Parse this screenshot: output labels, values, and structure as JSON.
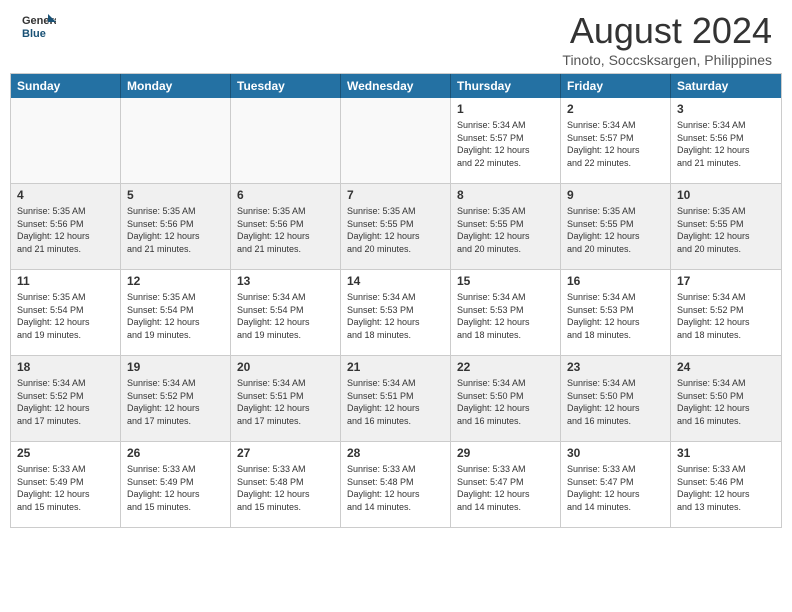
{
  "header": {
    "logo": {
      "general": "General",
      "blue": "Blue"
    },
    "month_year": "August 2024",
    "location": "Tinoto, Soccsksargen, Philippines"
  },
  "days_of_week": [
    "Sunday",
    "Monday",
    "Tuesday",
    "Wednesday",
    "Thursday",
    "Friday",
    "Saturday"
  ],
  "weeks": [
    [
      {
        "day": "",
        "info": "",
        "empty": true
      },
      {
        "day": "",
        "info": "",
        "empty": true
      },
      {
        "day": "",
        "info": "",
        "empty": true
      },
      {
        "day": "",
        "info": "",
        "empty": true
      },
      {
        "day": "1",
        "info": "Sunrise: 5:34 AM\nSunset: 5:57 PM\nDaylight: 12 hours\nand 22 minutes."
      },
      {
        "day": "2",
        "info": "Sunrise: 5:34 AM\nSunset: 5:57 PM\nDaylight: 12 hours\nand 22 minutes."
      },
      {
        "day": "3",
        "info": "Sunrise: 5:34 AM\nSunset: 5:56 PM\nDaylight: 12 hours\nand 21 minutes."
      }
    ],
    [
      {
        "day": "4",
        "info": "Sunrise: 5:35 AM\nSunset: 5:56 PM\nDaylight: 12 hours\nand 21 minutes."
      },
      {
        "day": "5",
        "info": "Sunrise: 5:35 AM\nSunset: 5:56 PM\nDaylight: 12 hours\nand 21 minutes."
      },
      {
        "day": "6",
        "info": "Sunrise: 5:35 AM\nSunset: 5:56 PM\nDaylight: 12 hours\nand 21 minutes."
      },
      {
        "day": "7",
        "info": "Sunrise: 5:35 AM\nSunset: 5:55 PM\nDaylight: 12 hours\nand 20 minutes."
      },
      {
        "day": "8",
        "info": "Sunrise: 5:35 AM\nSunset: 5:55 PM\nDaylight: 12 hours\nand 20 minutes."
      },
      {
        "day": "9",
        "info": "Sunrise: 5:35 AM\nSunset: 5:55 PM\nDaylight: 12 hours\nand 20 minutes."
      },
      {
        "day": "10",
        "info": "Sunrise: 5:35 AM\nSunset: 5:55 PM\nDaylight: 12 hours\nand 20 minutes."
      }
    ],
    [
      {
        "day": "11",
        "info": "Sunrise: 5:35 AM\nSunset: 5:54 PM\nDaylight: 12 hours\nand 19 minutes."
      },
      {
        "day": "12",
        "info": "Sunrise: 5:35 AM\nSunset: 5:54 PM\nDaylight: 12 hours\nand 19 minutes."
      },
      {
        "day": "13",
        "info": "Sunrise: 5:34 AM\nSunset: 5:54 PM\nDaylight: 12 hours\nand 19 minutes."
      },
      {
        "day": "14",
        "info": "Sunrise: 5:34 AM\nSunset: 5:53 PM\nDaylight: 12 hours\nand 18 minutes."
      },
      {
        "day": "15",
        "info": "Sunrise: 5:34 AM\nSunset: 5:53 PM\nDaylight: 12 hours\nand 18 minutes."
      },
      {
        "day": "16",
        "info": "Sunrise: 5:34 AM\nSunset: 5:53 PM\nDaylight: 12 hours\nand 18 minutes."
      },
      {
        "day": "17",
        "info": "Sunrise: 5:34 AM\nSunset: 5:52 PM\nDaylight: 12 hours\nand 18 minutes."
      }
    ],
    [
      {
        "day": "18",
        "info": "Sunrise: 5:34 AM\nSunset: 5:52 PM\nDaylight: 12 hours\nand 17 minutes."
      },
      {
        "day": "19",
        "info": "Sunrise: 5:34 AM\nSunset: 5:52 PM\nDaylight: 12 hours\nand 17 minutes."
      },
      {
        "day": "20",
        "info": "Sunrise: 5:34 AM\nSunset: 5:51 PM\nDaylight: 12 hours\nand 17 minutes."
      },
      {
        "day": "21",
        "info": "Sunrise: 5:34 AM\nSunset: 5:51 PM\nDaylight: 12 hours\nand 16 minutes."
      },
      {
        "day": "22",
        "info": "Sunrise: 5:34 AM\nSunset: 5:50 PM\nDaylight: 12 hours\nand 16 minutes."
      },
      {
        "day": "23",
        "info": "Sunrise: 5:34 AM\nSunset: 5:50 PM\nDaylight: 12 hours\nand 16 minutes."
      },
      {
        "day": "24",
        "info": "Sunrise: 5:34 AM\nSunset: 5:50 PM\nDaylight: 12 hours\nand 16 minutes."
      }
    ],
    [
      {
        "day": "25",
        "info": "Sunrise: 5:33 AM\nSunset: 5:49 PM\nDaylight: 12 hours\nand 15 minutes."
      },
      {
        "day": "26",
        "info": "Sunrise: 5:33 AM\nSunset: 5:49 PM\nDaylight: 12 hours\nand 15 minutes."
      },
      {
        "day": "27",
        "info": "Sunrise: 5:33 AM\nSunset: 5:48 PM\nDaylight: 12 hours\nand 15 minutes."
      },
      {
        "day": "28",
        "info": "Sunrise: 5:33 AM\nSunset: 5:48 PM\nDaylight: 12 hours\nand 14 minutes."
      },
      {
        "day": "29",
        "info": "Sunrise: 5:33 AM\nSunset: 5:47 PM\nDaylight: 12 hours\nand 14 minutes."
      },
      {
        "day": "30",
        "info": "Sunrise: 5:33 AM\nSunset: 5:47 PM\nDaylight: 12 hours\nand 14 minutes."
      },
      {
        "day": "31",
        "info": "Sunrise: 5:33 AM\nSunset: 5:46 PM\nDaylight: 12 hours\nand 13 minutes."
      }
    ]
  ]
}
